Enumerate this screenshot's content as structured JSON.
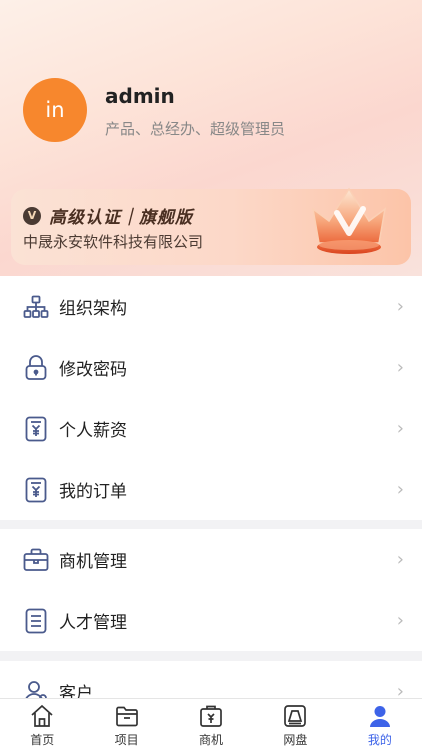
{
  "profile": {
    "avatar_text": "in",
    "username": "admin",
    "roles": "产品、总经办、超级管理员"
  },
  "certification": {
    "badge": "V",
    "title": "高级认证｜旗舰版",
    "company": "中晟永安软件科技有限公司"
  },
  "menu_group_1": [
    {
      "label": "组织架构",
      "icon": "org-chart-icon"
    },
    {
      "label": "修改密码",
      "icon": "lock-icon"
    },
    {
      "label": "个人薪资",
      "icon": "salary-icon"
    },
    {
      "label": "我的订单",
      "icon": "order-icon"
    }
  ],
  "menu_group_2": [
    {
      "label": "商机管理",
      "icon": "briefcase-icon"
    },
    {
      "label": "人才管理",
      "icon": "document-list-icon"
    }
  ],
  "menu_group_3": [
    {
      "label": "客户",
      "icon": "customer-icon"
    }
  ],
  "tabs": [
    {
      "label": "首页",
      "icon": "home-icon",
      "active": false
    },
    {
      "label": "项目",
      "icon": "folder-icon",
      "active": false
    },
    {
      "label": "商机",
      "icon": "opportunity-icon",
      "active": false
    },
    {
      "label": "网盘",
      "icon": "cloud-drive-icon",
      "active": false
    },
    {
      "label": "我的",
      "icon": "person-icon",
      "active": true
    }
  ],
  "colors": {
    "accent": "#3d63e8",
    "avatar": "#f7872d",
    "icon_stroke": "#4a5a8c"
  }
}
